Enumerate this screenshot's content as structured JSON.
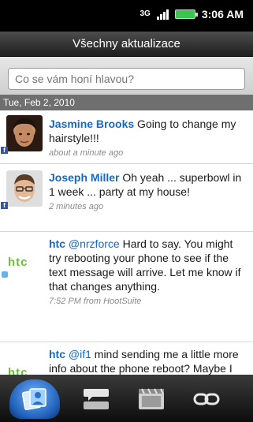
{
  "status_bar": {
    "network": "3G",
    "time": "3:06 AM",
    "icons": [
      "network-3g-icon",
      "signal-icon",
      "battery-icon"
    ]
  },
  "title_bar": {
    "title": "Všechny aktualizace"
  },
  "search": {
    "placeholder": "Co se vám honí hlavou?"
  },
  "feed": {
    "date_header": "Tue, Feb 2, 2010",
    "items": [
      {
        "author": "Jasmine Brooks",
        "text": " Going to change my hairstyle!!!",
        "meta": "about a minute ago",
        "source_icon": "facebook-icon"
      },
      {
        "author": "Joseph Miller",
        "text": " Oh yeah ... superbowl in 1 week ... party at my house!",
        "meta": "2 minutes ago",
        "source_icon": "facebook-icon"
      },
      {
        "author": "htc",
        "mention": "@nrzforce",
        "text": " Hard to say. You might try rebooting your phone to see if the text message will arrive. Let me know if that changes anything.",
        "meta": "7:52 PM from HootSuite",
        "source_icon": "twitter-icon",
        "logo_text": "htc"
      },
      {
        "author": "htc",
        "mention": "@if1",
        "text": " mind sending me a little more info about the phone reboot? Maybe I can help narrow down the issue. thx Ian!",
        "meta": "",
        "source_icon": "twitter-icon",
        "logo_text": "htc"
      }
    ]
  },
  "tabs": [
    {
      "icon": "all-updates-icon",
      "active": true
    },
    {
      "icon": "status-updates-icon",
      "active": false
    },
    {
      "icon": "photos-icon",
      "active": false
    },
    {
      "icon": "links-icon",
      "active": false
    }
  ],
  "colors": {
    "author_blue": "#1469c7",
    "htc_green": "#6abf3a",
    "facebook_blue": "#3b5998",
    "active_tab_blue": "#2e7fe0"
  }
}
